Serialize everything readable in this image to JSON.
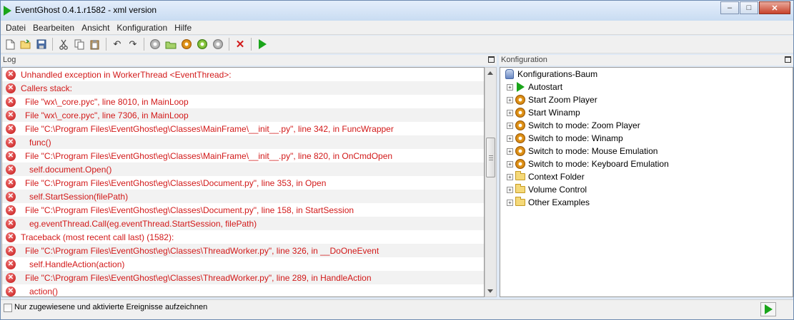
{
  "window": {
    "title": "EventGhost 0.4.1.r1582 - xml version",
    "minimize": "–",
    "maximize": "□",
    "close": "✕"
  },
  "menu": [
    "Datei",
    "Bearbeiten",
    "Ansicht",
    "Konfiguration",
    "Hilfe"
  ],
  "toolbar": {
    "icons": [
      "new-file-icon",
      "open-folder-icon",
      "save-icon",
      "cut-icon",
      "copy-icon",
      "paste-icon",
      "undo-icon",
      "redo-icon",
      "add-plugin-icon",
      "add-folder-icon",
      "add-macro-icon",
      "add-event-icon",
      "add-action-icon",
      "delete-icon",
      "execute-icon"
    ]
  },
  "log_pane": {
    "title": "Log",
    "lines": [
      {
        "text": "Unhandled exception in WorkerThread <EventThread>:",
        "indent": 0
      },
      {
        "text": "Callers stack:",
        "indent": 0
      },
      {
        "text": "File \"wx\\_core.pyc\", line 8010, in MainLoop",
        "indent": 1
      },
      {
        "text": "File \"wx\\_core.pyc\", line 7306, in MainLoop",
        "indent": 1
      },
      {
        "text": "File \"C:\\Program Files\\EventGhost\\eg\\Classes\\MainFrame\\__init__.py\", line 342, in FuncWrapper",
        "indent": 1
      },
      {
        "text": "func()",
        "indent": 2
      },
      {
        "text": "File \"C:\\Program Files\\EventGhost\\eg\\Classes\\MainFrame\\__init__.py\", line 820, in OnCmdOpen",
        "indent": 1
      },
      {
        "text": "self.document.Open()",
        "indent": 2
      },
      {
        "text": "File \"C:\\Program Files\\EventGhost\\eg\\Classes\\Document.py\", line 353, in Open",
        "indent": 1
      },
      {
        "text": "self.StartSession(filePath)",
        "indent": 2
      },
      {
        "text": "File \"C:\\Program Files\\EventGhost\\eg\\Classes\\Document.py\", line 158, in StartSession",
        "indent": 1
      },
      {
        "text": "eg.eventThread.Call(eg.eventThread.StartSession, filePath)",
        "indent": 2
      },
      {
        "text": "Traceback (most recent call last) (1582):",
        "indent": 0
      },
      {
        "text": "File \"C:\\Program Files\\EventGhost\\eg\\Classes\\ThreadWorker.py\", line 326, in __DoOneEvent",
        "indent": 1
      },
      {
        "text": "self.HandleAction(action)",
        "indent": 2
      },
      {
        "text": "File \"C:\\Program Files\\EventGhost\\eg\\Classes\\ThreadWorker.py\", line 289, in HandleAction",
        "indent": 1
      },
      {
        "text": "action()",
        "indent": 2
      }
    ]
  },
  "config_pane": {
    "title": "Konfiguration",
    "root": "Konfigurations-Baum",
    "items": [
      {
        "label": "Autostart",
        "icon": "autostart-icon"
      },
      {
        "label": "Start Zoom Player",
        "icon": "macro-icon"
      },
      {
        "label": "Start Winamp",
        "icon": "macro-icon"
      },
      {
        "label": "Switch to mode: Zoom Player",
        "icon": "macro-icon"
      },
      {
        "label": "Switch to mode: Winamp",
        "icon": "macro-icon"
      },
      {
        "label": "Switch to mode: Mouse Emulation",
        "icon": "macro-icon"
      },
      {
        "label": "Switch to mode: Keyboard Emulation",
        "icon": "macro-icon"
      },
      {
        "label": "Context Folder",
        "icon": "folder-icon"
      },
      {
        "label": "Volume Control",
        "icon": "folder-icon"
      },
      {
        "label": "Other Examples",
        "icon": "folder-icon"
      }
    ]
  },
  "statusbar": {
    "checkbox_label": "Nur zugewiesene und aktivierte Ereignisse aufzeichnen",
    "checked": false
  }
}
